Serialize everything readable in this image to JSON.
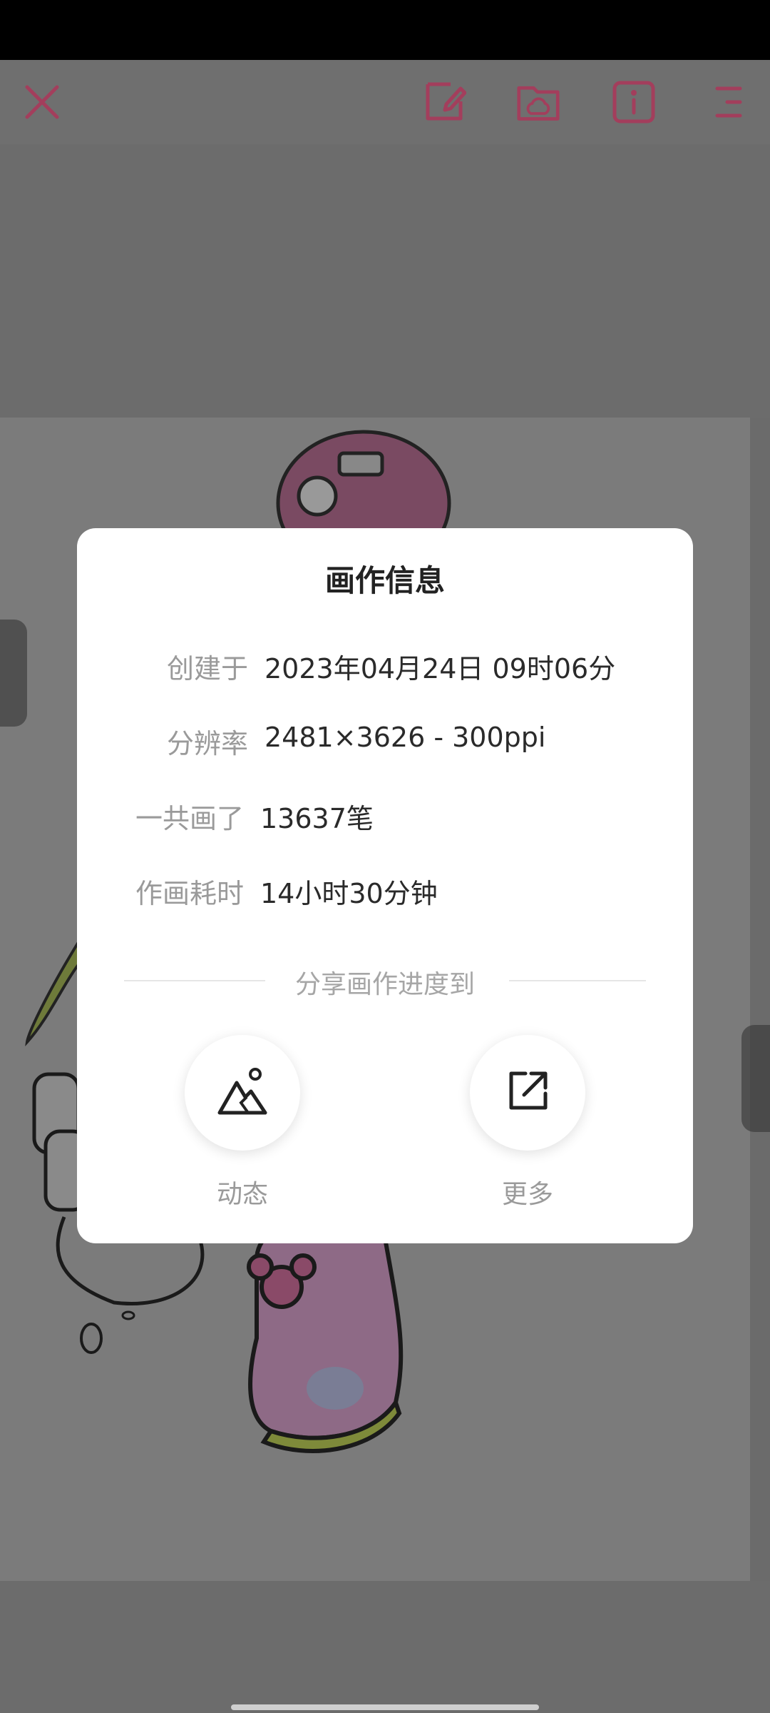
{
  "dialog": {
    "title": "画作信息",
    "rows": [
      {
        "label": "创建于",
        "value": "2023年04月24日 09时06分"
      },
      {
        "label": "分辨率",
        "value": "2481×3626 - 300ppi"
      },
      {
        "label": "一共画了",
        "value": "13637笔"
      },
      {
        "label": "作画耗时",
        "value": "14小时30分钟"
      }
    ],
    "share_heading": "分享画作进度到",
    "share_buttons": [
      {
        "label": "动态",
        "icon": "mountain-image-icon"
      },
      {
        "label": "更多",
        "icon": "external-link-icon"
      }
    ]
  },
  "colors": {
    "accent": "#c23a66",
    "current_color": "#5a2a45"
  }
}
